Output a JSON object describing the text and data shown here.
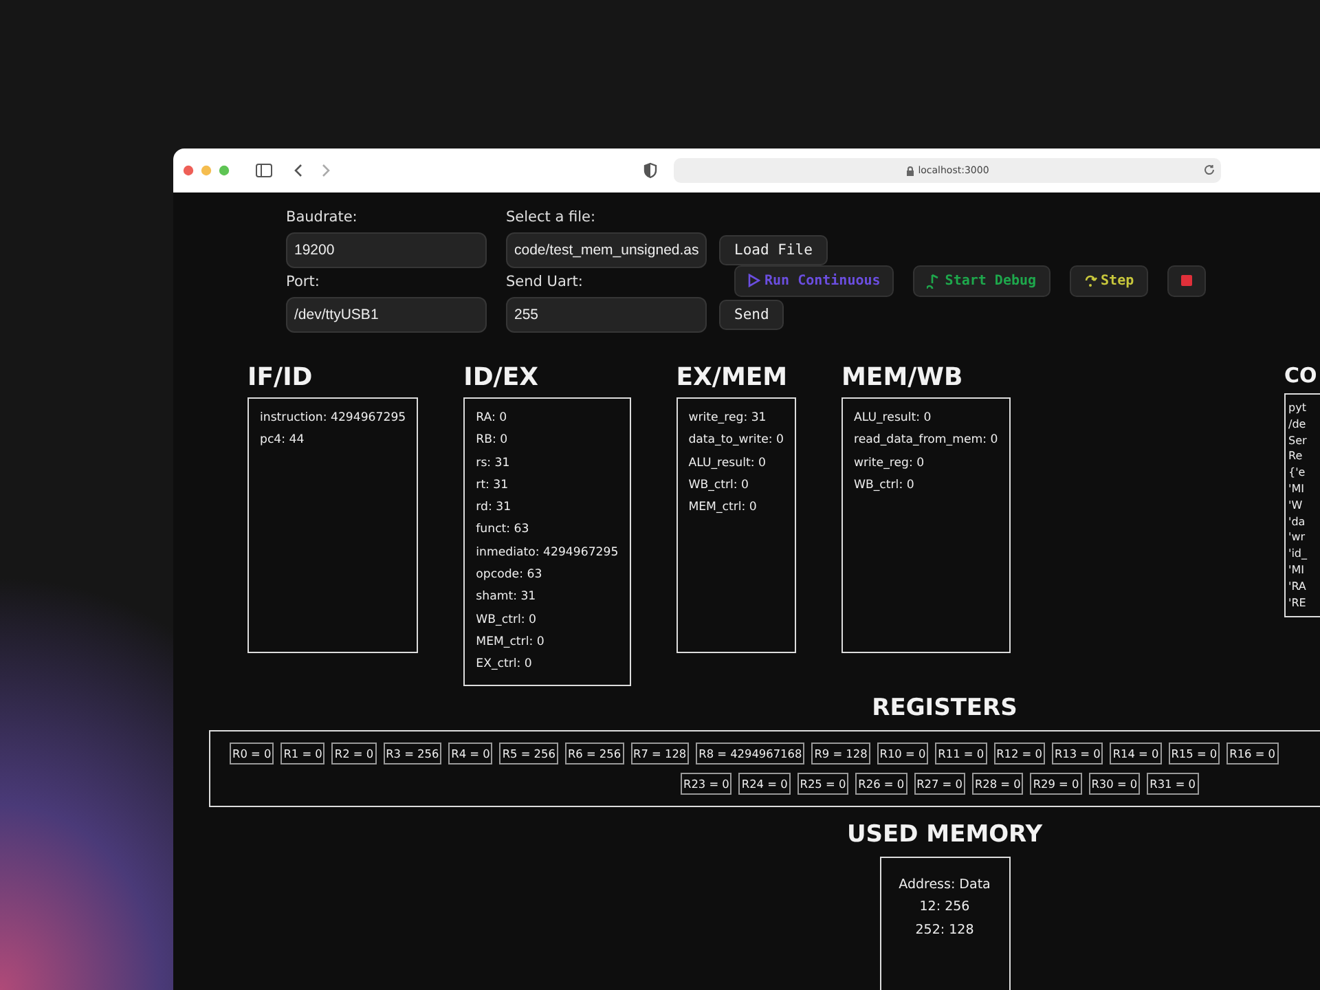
{
  "browser": {
    "url": "localhost:3000"
  },
  "form": [
    {
      "label": "Baudrate:",
      "value": "19200"
    },
    {
      "label": "Select a file:",
      "value": "code/test_mem_unsigned.as",
      "button": "Load File"
    },
    {
      "label": "Port:",
      "value": "/dev/ttyUSB1"
    },
    {
      "label": "Send Uart:",
      "value": "255",
      "button": "Send"
    }
  ],
  "debug_buttons": [
    {
      "label": "Run Continuous",
      "kind": "run"
    },
    {
      "label": "Start Debug",
      "kind": "debug"
    },
    {
      "label": "Step",
      "kind": "step"
    },
    {
      "kind": "stop"
    }
  ],
  "stages": [
    {
      "title": "IF/ID",
      "lines": [
        "instruction: 4294967295",
        "pc4: 44"
      ]
    },
    {
      "title": "ID/EX",
      "lines": [
        "RA: 0",
        "RB: 0",
        "rs: 31",
        "rt: 31",
        "rd: 31",
        "funct: 63",
        "inmediato: 4294967295",
        "opcode: 63",
        "shamt: 31",
        "WB_ctrl: 0",
        "MEM_ctrl: 0",
        "EX_ctrl: 0"
      ]
    },
    {
      "title": "EX/MEM",
      "lines": [
        "write_reg: 31",
        "data_to_write: 0",
        "ALU_result: 0",
        "WB_ctrl: 0",
        "MEM_ctrl: 0"
      ]
    },
    {
      "title": "MEM/WB",
      "lines": [
        "ALU_result: 0",
        "read_data_from_mem: 0",
        "write_reg: 0",
        "WB_ctrl: 0"
      ]
    }
  ],
  "console": {
    "title": "CO",
    "lines": [
      "pyt",
      "/de",
      "Ser",
      "Re",
      "{'e",
      "'MI",
      "'W",
      "'da",
      "'wr",
      "'id_",
      "'MI",
      "'RA",
      "'RE"
    ]
  },
  "registers": {
    "title": "REGISTERS",
    "top_row": [
      "R0 = 0",
      "R1 = 0",
      "R2 = 0",
      "R3 = 256",
      "R4 = 0",
      "R5 = 256",
      "R6 = 256",
      "R7 = 128",
      "R8 = 4294967168",
      "R9 = 128",
      "R10 = 0",
      "R11 = 0",
      "R12 = 0",
      "R13 = 0",
      "R14 = 0",
      "R15 = 0",
      "R16 = 0"
    ],
    "bottom_row": [
      "R23 = 0",
      "R24 = 0",
      "R25 = 0",
      "R26 = 0",
      "R27 = 0",
      "R28 = 0",
      "R29 = 0",
      "R30 = 0",
      "R31 = 0"
    ]
  },
  "memory": {
    "title": "USED MEMORY",
    "lines": [
      "Address: Data",
      "12: 256",
      "252: 128"
    ]
  }
}
